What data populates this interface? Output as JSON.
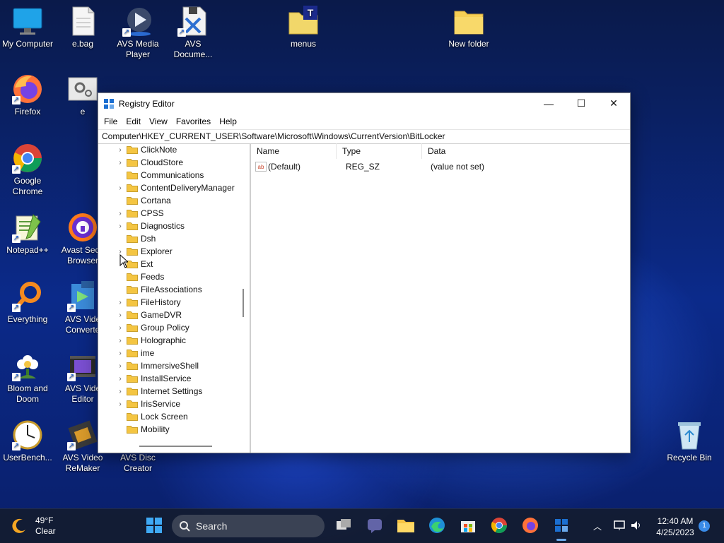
{
  "desktop": {
    "icons": [
      {
        "label": "My Computer"
      },
      {
        "label": "e.bag"
      },
      {
        "label": "AVS Media Player"
      },
      {
        "label": "AVS Docume..."
      },
      {
        "label": "menus"
      },
      {
        "label": "New folder"
      },
      {
        "label": "Firefox"
      },
      {
        "label": "e"
      },
      {
        "label": "Google Chrome"
      },
      {
        "label": "Notepad++"
      },
      {
        "label": "Avast Secu Browser"
      },
      {
        "label": "Everything"
      },
      {
        "label": "AVS Vide Converte"
      },
      {
        "label": "Bloom and Doom"
      },
      {
        "label": "AVS Vide Editor"
      },
      {
        "label": "UserBench..."
      },
      {
        "label": "AVS Video ReMaker"
      },
      {
        "label": "AVS Disc Creator"
      },
      {
        "label": "Recycle Bin"
      }
    ]
  },
  "window": {
    "title": "Registry Editor",
    "minimize": "—",
    "maximize": "☐",
    "close": "✕",
    "menu": [
      "File",
      "Edit",
      "View",
      "Favorites",
      "Help"
    ],
    "address": "Computer\\HKEY_CURRENT_USER\\Software\\Microsoft\\Windows\\CurrentVersion\\BitLocker",
    "tree": [
      {
        "label": "ClickNote",
        "expandable": true
      },
      {
        "label": "CloudStore",
        "expandable": true
      },
      {
        "label": "Communications",
        "expandable": false
      },
      {
        "label": "ContentDeliveryManager",
        "expandable": true
      },
      {
        "label": "Cortana",
        "expandable": false
      },
      {
        "label": "CPSS",
        "expandable": true
      },
      {
        "label": "Diagnostics",
        "expandable": true
      },
      {
        "label": "Dsh",
        "expandable": false
      },
      {
        "label": "Explorer",
        "expandable": true
      },
      {
        "label": "Ext",
        "expandable": false
      },
      {
        "label": "Feeds",
        "expandable": false
      },
      {
        "label": "FileAssociations",
        "expandable": false
      },
      {
        "label": "FileHistory",
        "expandable": true
      },
      {
        "label": "GameDVR",
        "expandable": true
      },
      {
        "label": "Group Policy",
        "expandable": true
      },
      {
        "label": "Holographic",
        "expandable": true
      },
      {
        "label": "ime",
        "expandable": true
      },
      {
        "label": "ImmersiveShell",
        "expandable": true
      },
      {
        "label": "InstallService",
        "expandable": true
      },
      {
        "label": "Internet Settings",
        "expandable": true
      },
      {
        "label": "IrisService",
        "expandable": true
      },
      {
        "label": "Lock Screen",
        "expandable": false
      },
      {
        "label": "Mobility",
        "expandable": false
      }
    ],
    "columns": {
      "name": "Name",
      "type": "Type",
      "data": "Data"
    },
    "values": [
      {
        "name": "(Default)",
        "type": "REG_SZ",
        "data": "(value not set)"
      }
    ]
  },
  "taskbar": {
    "weather_temp": "49°F",
    "weather_desc": "Clear",
    "search_label": "Search",
    "time": "12:40 AM",
    "date": "4/25/2023",
    "notification_count": "1"
  },
  "colors": {
    "folder": "#f4c542",
    "accent": "#0a64d8",
    "taskbar_bg": "#141c30"
  }
}
